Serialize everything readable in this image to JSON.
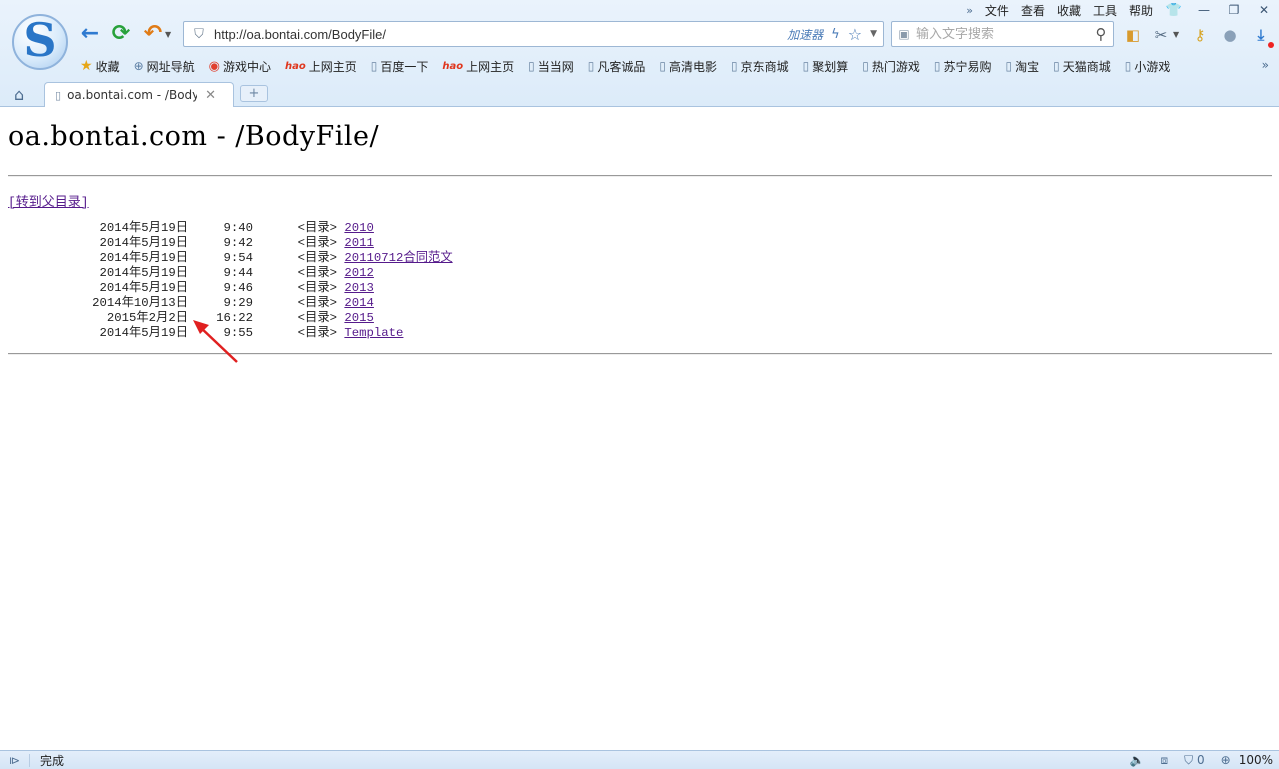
{
  "menubar": {
    "items": [
      "文件",
      "查看",
      "收藏",
      "工具",
      "帮助"
    ]
  },
  "address": {
    "url": "http://oa.bontai.com/BodyFile/",
    "accelerator": "加速器"
  },
  "search": {
    "placeholder": "输入文字搜索"
  },
  "bookmarks": [
    {
      "label": "收藏",
      "icon": "star-icon"
    },
    {
      "label": "网址导航",
      "icon": "globe-icon"
    },
    {
      "label": "游戏中心",
      "icon": "game-icon"
    },
    {
      "label": "上网主页",
      "icon": "hao-icon"
    },
    {
      "label": "百度一下",
      "icon": "page-icon"
    },
    {
      "label": "上网主页",
      "icon": "hao-icon"
    },
    {
      "label": "当当网",
      "icon": "page-icon"
    },
    {
      "label": "凡客诚品",
      "icon": "page-icon"
    },
    {
      "label": "高清电影",
      "icon": "page-icon"
    },
    {
      "label": "京东商城",
      "icon": "page-icon"
    },
    {
      "label": "聚划算",
      "icon": "page-icon"
    },
    {
      "label": "热门游戏",
      "icon": "page-icon"
    },
    {
      "label": "苏宁易购",
      "icon": "page-icon"
    },
    {
      "label": "淘宝",
      "icon": "page-icon"
    },
    {
      "label": "天猫商城",
      "icon": "page-icon"
    },
    {
      "label": "小游戏",
      "icon": "page-icon"
    }
  ],
  "tab": {
    "title": "oa.bontai.com - /BodyFile/"
  },
  "page": {
    "heading": "oa.bontai.com - /BodyFile/",
    "parent_link": "[转到父目录]",
    "entries": [
      {
        "date": "2014年5月19日",
        "time": "9:40",
        "type": "<目录>",
        "name": "2010"
      },
      {
        "date": "2014年5月19日",
        "time": "9:42",
        "type": "<目录>",
        "name": "2011"
      },
      {
        "date": "2014年5月19日",
        "time": "9:54",
        "type": "<目录>",
        "name": "20110712合同范文"
      },
      {
        "date": "2014年5月19日",
        "time": "9:44",
        "type": "<目录>",
        "name": "2012"
      },
      {
        "date": "2014年5月19日",
        "time": "9:46",
        "type": "<目录>",
        "name": "2013"
      },
      {
        "date": "2014年10月13日",
        "time": "9:29",
        "type": "<目录>",
        "name": "2014"
      },
      {
        "date": "2015年2月2日",
        "time": "16:22",
        "type": "<目录>",
        "name": "2015"
      },
      {
        "date": "2014年5月19日",
        "time": "9:55",
        "type": "<目录>",
        "name": "Template"
      }
    ]
  },
  "status": {
    "text": "完成",
    "badge_count": "0",
    "zoom": "100%"
  },
  "colors": {
    "link_visited": "#551a8b",
    "annotation_arrow": "#e02020",
    "chrome_bg": "#dcebf9"
  }
}
